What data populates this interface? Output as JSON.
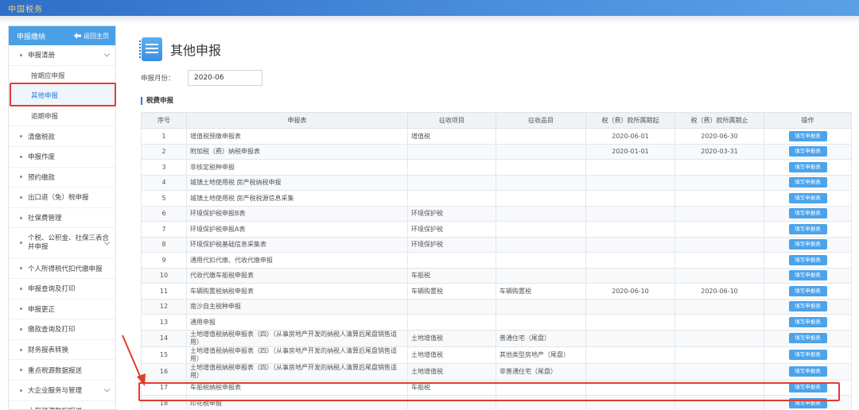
{
  "header": {
    "logo_text": "中国税务"
  },
  "sidebar": {
    "title": "申报缴纳",
    "back_label": "返回主页",
    "groups": [
      {
        "label": "申报清册",
        "expandable": true
      },
      {
        "label": "按期应申报",
        "sub": true
      },
      {
        "label": "其他申报",
        "sub": true,
        "active": true
      },
      {
        "label": "逾期申报",
        "sub": true
      },
      {
        "label": "清缴税款"
      },
      {
        "label": "申报作废"
      },
      {
        "label": "预约缴款"
      },
      {
        "label": "出口退（免）税申报"
      },
      {
        "label": "社保费管理"
      },
      {
        "label": "个税、公积金、社保三表合并申报",
        "expandable": true
      },
      {
        "label": "个人所得税代扣代缴申报"
      },
      {
        "label": "申报查询及打印"
      },
      {
        "label": "申报更正"
      },
      {
        "label": "缴款查询及打印"
      },
      {
        "label": "财务报表转换"
      },
      {
        "label": "重点税源数据报送"
      },
      {
        "label": "大企业服务与管理",
        "expandable": true
      },
      {
        "label": "大型税源数据报送"
      }
    ]
  },
  "main": {
    "page_title": "其他申报",
    "month_label": "申报月份：",
    "month_value": "2020-06",
    "section_title": "税费申报",
    "columns": [
      "序号",
      "申报表",
      "征收项目",
      "征收品目",
      "税（费）款所属期起",
      "税（费）款所属期止",
      "操作"
    ],
    "action_label": "填写申报表",
    "rows": [
      {
        "no": "1",
        "form": "增值税预缴申报表",
        "item": "增值税",
        "sub": "",
        "start": "2020-06-01",
        "end": "2020-06-30"
      },
      {
        "no": "2",
        "form": "附加税（费）纳税申报表",
        "item": "",
        "sub": "",
        "start": "2020-01-01",
        "end": "2020-03-31"
      },
      {
        "no": "3",
        "form": "非核定税种申报",
        "item": "",
        "sub": "",
        "start": "",
        "end": ""
      },
      {
        "no": "4",
        "form": "城镇土地使用税 房产税纳税申报",
        "item": "",
        "sub": "",
        "start": "",
        "end": ""
      },
      {
        "no": "5",
        "form": "城镇土地使用税 房产税税源信息采集",
        "item": "",
        "sub": "",
        "start": "",
        "end": ""
      },
      {
        "no": "6",
        "form": "环境保护税申报B表",
        "item": "环境保护税",
        "sub": "",
        "start": "",
        "end": ""
      },
      {
        "no": "7",
        "form": "环境保护税申报A表",
        "item": "环境保护税",
        "sub": "",
        "start": "",
        "end": ""
      },
      {
        "no": "8",
        "form": "环境保护税基础信息采集表",
        "item": "环境保护税",
        "sub": "",
        "start": "",
        "end": ""
      },
      {
        "no": "9",
        "form": "通用代扣代缴、代收代缴申报",
        "item": "",
        "sub": "",
        "start": "",
        "end": ""
      },
      {
        "no": "10",
        "form": "代收代缴车船税申报表",
        "item": "车船税",
        "sub": "",
        "start": "",
        "end": ""
      },
      {
        "no": "11",
        "form": "车辆购置税纳税申报表",
        "item": "车辆购置税",
        "sub": "车辆购置税",
        "start": "2020-06-10",
        "end": "2020-06-10"
      },
      {
        "no": "12",
        "form": "南沙自主税种申报",
        "item": "",
        "sub": "",
        "start": "",
        "end": ""
      },
      {
        "no": "13",
        "form": "通用申报",
        "item": "",
        "sub": "",
        "start": "",
        "end": ""
      },
      {
        "no": "14",
        "form": "土地增值税纳税申报表（四）（从事房地产开发的纳税人清算后尾盘销售适用）",
        "item": "土地增值税",
        "sub": "普通住宅（尾盘）",
        "start": "",
        "end": ""
      },
      {
        "no": "15",
        "form": "土地增值税纳税申报表（四）（从事房地产开发的纳税人清算后尾盘销售适用）",
        "item": "土地增值税",
        "sub": "其他类型房地产（尾盘）",
        "start": "",
        "end": ""
      },
      {
        "no": "16",
        "form": "土地增值税纳税申报表（四）（从事房地产开发的纳税人清算后尾盘销售适用）",
        "item": "土地增值税",
        "sub": "非普通住宅（尾盘）",
        "start": "",
        "end": ""
      },
      {
        "no": "17",
        "form": "车船税纳税申报表",
        "item": "车船税",
        "sub": "",
        "start": "",
        "end": ""
      },
      {
        "no": "18",
        "form": "印花税申报",
        "item": "",
        "sub": "",
        "start": "",
        "end": ""
      }
    ]
  },
  "colors": {
    "accent": "#4aa0e6",
    "highlight": "#e23b2e"
  }
}
